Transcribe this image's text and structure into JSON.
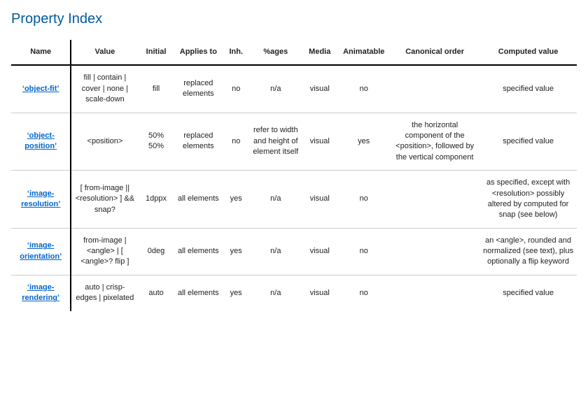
{
  "title": "Property Index",
  "headers": {
    "name": "Name",
    "value": "Value",
    "initial": "Initial",
    "applies_to": "Applies to",
    "inherited": "Inh.",
    "percentages": "%ages",
    "media": "Media",
    "animatable": "Animatable",
    "canonical": "Canonical order",
    "computed": "Computed value"
  },
  "rows": [
    {
      "name": "‘object-fit’",
      "value": "fill | contain | cover | none | scale-down",
      "initial": "fill",
      "applies_to": "replaced elements",
      "inherited": "no",
      "percentages": "n/a",
      "media": "visual",
      "animatable": "no",
      "canonical": "",
      "computed": "specified value"
    },
    {
      "name": "‘object-position’",
      "value": "<position>",
      "initial": "50% 50%",
      "applies_to": "replaced elements",
      "inherited": "no",
      "percentages": "refer to width and height of element itself",
      "media": "visual",
      "animatable": "yes",
      "canonical": "the horizontal component of the <position>, followed by the vertical component",
      "computed": "specified value"
    },
    {
      "name": "‘image-resolution’",
      "value": "[ from-image || <resolution> ] && snap?",
      "initial": "1dppx",
      "applies_to": "all elements",
      "inherited": "yes",
      "percentages": "n/a",
      "media": "visual",
      "animatable": "no",
      "canonical": "",
      "computed": "as specified, except with <resolution> possibly altered by computed for snap (see below)"
    },
    {
      "name": "‘image-orientation’",
      "value": "from-image | <angle> | [ <angle>? flip ]",
      "initial": "0deg",
      "applies_to": "all elements",
      "inherited": "yes",
      "percentages": "n/a",
      "media": "visual",
      "animatable": "no",
      "canonical": "",
      "computed": "an <angle>, rounded and normalized (see text), plus optionally a flip keyword"
    },
    {
      "name": "‘image-rendering’",
      "value": "auto | crisp-edges | pixelated",
      "initial": "auto",
      "applies_to": "all elements",
      "inherited": "yes",
      "percentages": "n/a",
      "media": "visual",
      "animatable": "no",
      "canonical": "",
      "computed": "specified value"
    }
  ]
}
